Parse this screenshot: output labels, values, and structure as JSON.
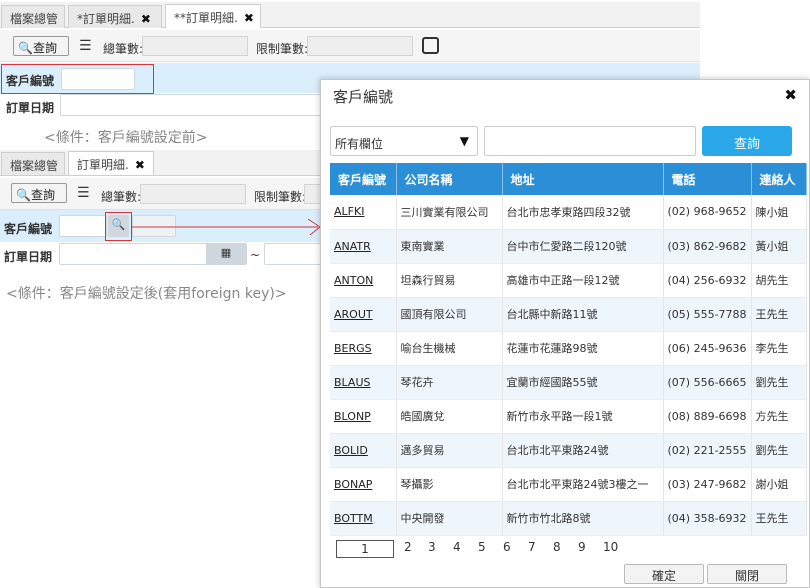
{
  "top": {
    "tabs": [
      {
        "label": "檔案總管",
        "closable": false
      },
      {
        "label": "*訂單明細.",
        "closable": true
      },
      {
        "label": "**訂單明細.",
        "closable": true
      }
    ],
    "toolbar": {
      "query_label": "查詢",
      "total_label": "總筆數:",
      "limit_label": "限制筆數:"
    },
    "fields": {
      "customer_label": "客戶編號",
      "order_date_label": "訂單日期"
    },
    "note": "<條件：客戶編號設定前>"
  },
  "bottom": {
    "tabs": [
      {
        "label": "檔案總管",
        "closable": false
      },
      {
        "label": "訂單明細.",
        "closable": true
      }
    ],
    "toolbar": {
      "query_label": "查詢",
      "total_label": "總筆數:",
      "limit_label": "限制筆數:"
    },
    "fields": {
      "customer_label": "客戶編號",
      "order_date_label": "訂單日期",
      "range_sep": "~"
    },
    "note": "<條件：客戶編號設定後(套用foreign key)>"
  },
  "modal": {
    "title": "客戶編號",
    "field_select": "所有欄位",
    "search_button": "查詢",
    "columns": [
      "客戶編號",
      "公司名稱",
      "地址",
      "電話",
      "連絡人"
    ],
    "rows": [
      [
        "ALFKI",
        "三川實業有限公司",
        "台北市忠孝東路四段32號",
        "(02) 968-9652",
        "陳小姐"
      ],
      [
        "ANATR",
        "東南實業",
        "台中市仁愛路二段120號",
        "(03) 862-9682",
        "黃小姐"
      ],
      [
        "ANTON",
        "坦森行貿易",
        "高雄市中正路一段12號",
        "(04) 256-6932",
        "胡先生"
      ],
      [
        "AROUT",
        "國頂有限公司",
        "台北縣中新路11號",
        "(05) 555-7788",
        "王先生"
      ],
      [
        "BERGS",
        "喻台生機械",
        "花蓮市花蓮路98號",
        "(06) 245-9636",
        "李先生"
      ],
      [
        "BLAUS",
        "琴花卉",
        "宜蘭市經國路55號",
        "(07) 556-6665",
        "劉先生"
      ],
      [
        "BLONP",
        "皓國廣兌",
        "新竹市永平路一段1號",
        "(08) 889-6698",
        "方先生"
      ],
      [
        "BOLID",
        "邁多貿易",
        "台北市北平東路24號",
        "(02) 221-2555",
        "劉先生"
      ],
      [
        "BONAP",
        "琴攝影",
        "台北市北平東路24號3樓之一",
        "(03) 247-9682",
        "謝小姐"
      ],
      [
        "BOTTM",
        "中央開發",
        "新竹市竹北路8號",
        "(04) 358-6932",
        "王先生"
      ]
    ],
    "pages": [
      "1",
      "2",
      "3",
      "4",
      "5",
      "6",
      "7",
      "8",
      "9",
      "10"
    ],
    "current_page": "1",
    "ok_button": "確定",
    "close_button": "關閉"
  },
  "colors": {
    "header_blue": "#2b8fd7",
    "query_blue": "#2aa7e8",
    "row_alt": "#eef5fb",
    "form_bg": "#dbeefb",
    "highlight_red": "#d9343a"
  }
}
